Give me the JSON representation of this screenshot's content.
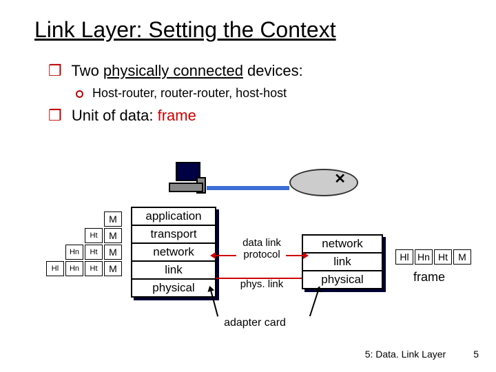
{
  "title": "Link Layer: Setting the Context",
  "bullets": {
    "b1_prefix": "Two ",
    "b1_underlined": "physically connected",
    "b1_suffix": " devices:",
    "b1_sub": "Host-router, router-router, host-host",
    "b2_prefix": "Unit of data: ",
    "b2_red": "frame"
  },
  "stackA": {
    "l1": "application",
    "l2": "transport",
    "l3": "network",
    "l4": "link",
    "l5": "physical"
  },
  "stackB": {
    "l1": "network",
    "l2": "link",
    "l3": "physical"
  },
  "encapsulation": {
    "r1": {
      "c4": "M"
    },
    "r2": {
      "c3": "Ht",
      "c4": "M"
    },
    "r3": {
      "c2": "Hn",
      "c3": "Ht",
      "c4": "M"
    },
    "r4": {
      "c1": "Hl",
      "c2": "Hn",
      "c3": "Ht",
      "c4": "M"
    }
  },
  "frame_right": {
    "c1": "Hl",
    "c2": "Hn",
    "c3": "Ht",
    "c4": "M"
  },
  "labels": {
    "data_link_protocol": "data link protocol",
    "phys_link": "phys. link",
    "adapter_card": "adapter card",
    "frame": "frame"
  },
  "footer": {
    "chapter": "5: Data. Link Layer",
    "page": "5"
  }
}
